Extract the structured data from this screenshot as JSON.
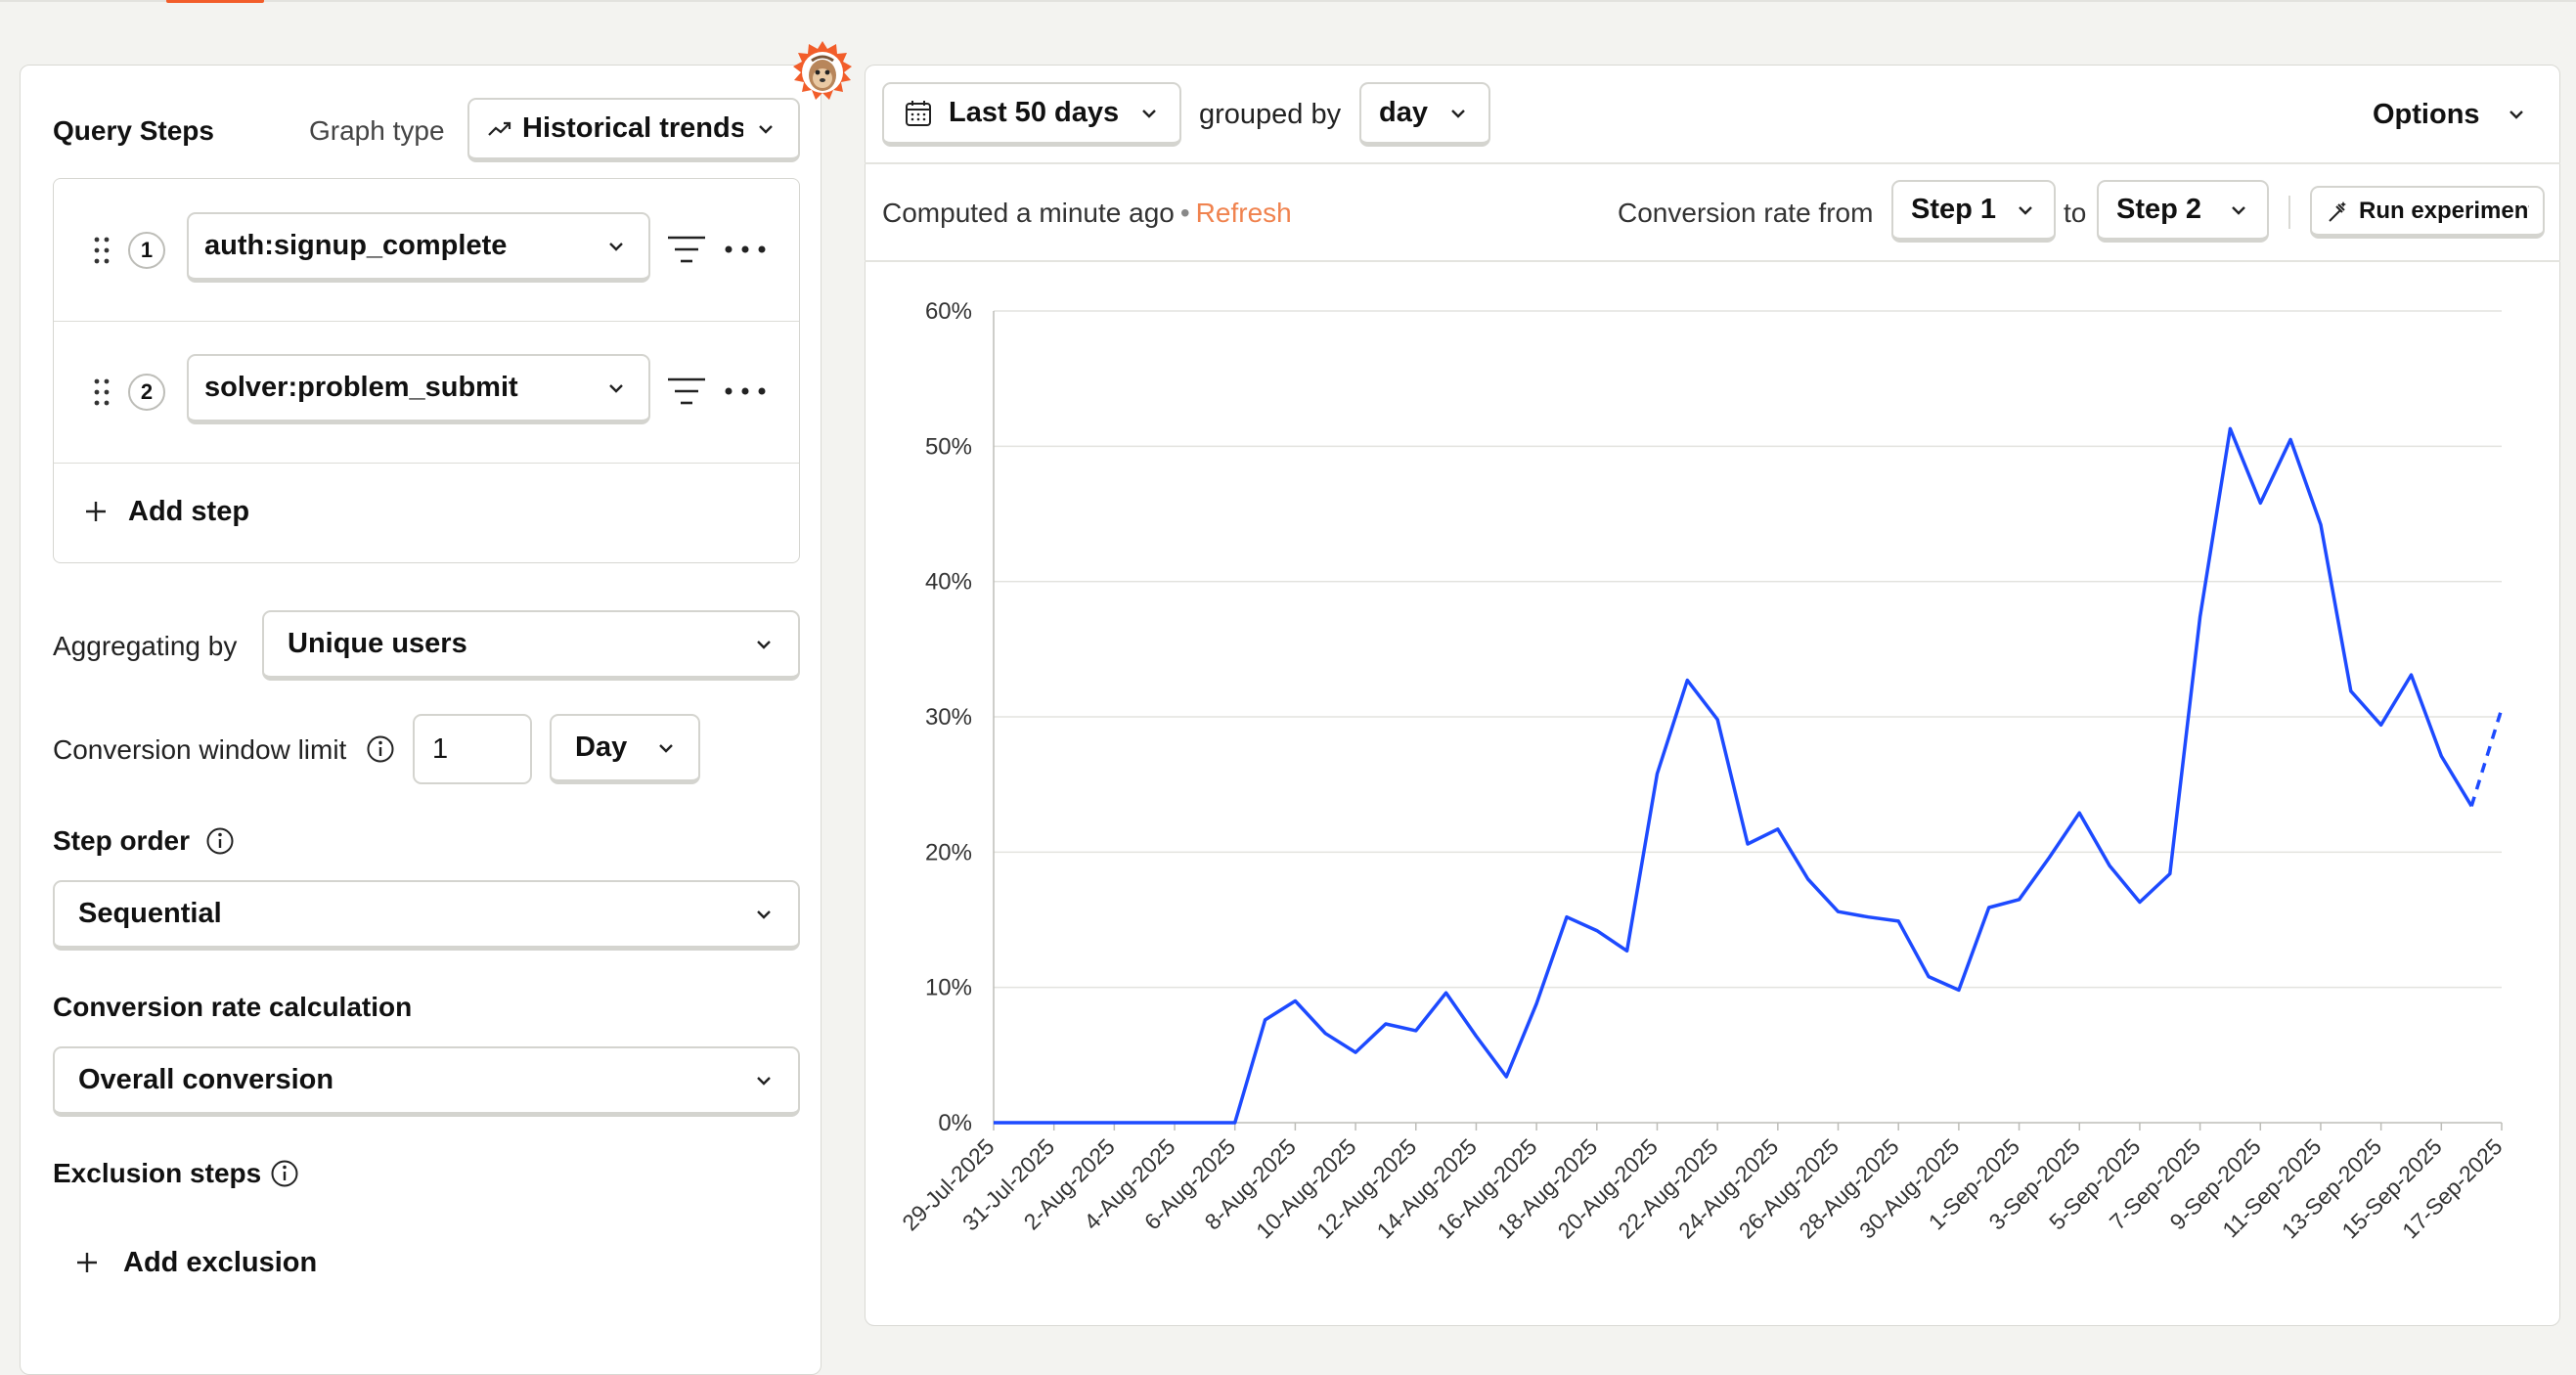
{
  "query_panel": {
    "title": "Query Steps",
    "graph_type_label": "Graph type",
    "graph_type_value": "Historical trends",
    "steps": [
      {
        "number": "1",
        "event": "auth:signup_complete"
      },
      {
        "number": "2",
        "event": "solver:problem_submit"
      }
    ],
    "add_step_label": "Add step",
    "aggregating_label": "Aggregating by",
    "aggregating_value": "Unique users",
    "conversion_window_label": "Conversion window limit",
    "conversion_window_value": "1",
    "conversion_window_unit": "Day",
    "step_order_label": "Step order",
    "step_order_value": "Sequential",
    "conversion_calc_label": "Conversion rate calculation",
    "conversion_calc_value": "Overall conversion",
    "exclusion_label": "Exclusion steps",
    "add_exclusion_label": "Add exclusion"
  },
  "toolbar": {
    "date_range": "Last 50 days",
    "grouped_by_label": "grouped by",
    "interval": "day",
    "options_label": "Options",
    "computed_label": "Computed a minute ago",
    "separator": "•",
    "refresh_label": "Refresh",
    "conversion_from_label": "Conversion rate from",
    "from_step": "Step 1",
    "to_label": "to",
    "to_step": "Step 2",
    "run_experiment_label": "Run experiment"
  },
  "colors": {
    "line": "#1d4aff",
    "accent": "#f25d2a",
    "refresh": "#f0834f"
  },
  "chart_data": {
    "type": "line",
    "ylim": [
      0,
      60
    ],
    "y_ticks": [
      0,
      10,
      20,
      30,
      40,
      50,
      60
    ],
    "y_tick_labels": [
      "0%",
      "10%",
      "20%",
      "30%",
      "40%",
      "50%",
      "60%"
    ],
    "grid": true,
    "x": [
      "29-Jul-2025",
      "30-Jul-2025",
      "31-Jul-2025",
      "1-Aug-2025",
      "2-Aug-2025",
      "3-Aug-2025",
      "4-Aug-2025",
      "5-Aug-2025",
      "6-Aug-2025",
      "7-Aug-2025",
      "8-Aug-2025",
      "9-Aug-2025",
      "10-Aug-2025",
      "11-Aug-2025",
      "12-Aug-2025",
      "13-Aug-2025",
      "14-Aug-2025",
      "15-Aug-2025",
      "16-Aug-2025",
      "17-Aug-2025",
      "18-Aug-2025",
      "19-Aug-2025",
      "20-Aug-2025",
      "21-Aug-2025",
      "22-Aug-2025",
      "23-Aug-2025",
      "24-Aug-2025",
      "25-Aug-2025",
      "26-Aug-2025",
      "27-Aug-2025",
      "28-Aug-2025",
      "29-Aug-2025",
      "30-Aug-2025",
      "31-Aug-2025",
      "1-Sep-2025",
      "2-Sep-2025",
      "3-Sep-2025",
      "4-Sep-2025",
      "5-Sep-2025",
      "6-Sep-2025",
      "7-Sep-2025",
      "8-Sep-2025",
      "9-Sep-2025",
      "10-Sep-2025",
      "11-Sep-2025",
      "12-Sep-2025",
      "13-Sep-2025",
      "14-Sep-2025",
      "15-Sep-2025",
      "16-Sep-2025",
      "17-Sep-2025"
    ],
    "x_tick_labels": [
      "29-Jul-2025",
      "31-Jul-2025",
      "2-Aug-2025",
      "4-Aug-2025",
      "6-Aug-2025",
      "8-Aug-2025",
      "10-Aug-2025",
      "12-Aug-2025",
      "14-Aug-2025",
      "16-Aug-2025",
      "18-Aug-2025",
      "20-Aug-2025",
      "22-Aug-2025",
      "24-Aug-2025",
      "26-Aug-2025",
      "28-Aug-2025",
      "30-Aug-2025",
      "1-Sep-2025",
      "3-Sep-2025",
      "5-Sep-2025",
      "7-Sep-2025",
      "9-Sep-2025",
      "11-Sep-2025",
      "13-Sep-2025",
      "15-Sep-2025",
      "17-Sep-2025"
    ],
    "series": [
      {
        "values": [
          0,
          0,
          0,
          0,
          0,
          0,
          0,
          0,
          0,
          7.6,
          9.0,
          6.6,
          5.2,
          7.3,
          6.8,
          9.6,
          6.4,
          3.4,
          8.8,
          15.2,
          14.2,
          12.7,
          25.8,
          32.7,
          29.8,
          20.6,
          21.7,
          18.0,
          15.6,
          15.2,
          14.9,
          10.8,
          9.8,
          15.9,
          16.5,
          19.6,
          22.9,
          19.0,
          16.3,
          18.4,
          37.4,
          51.3,
          45.8,
          50.5,
          44.2,
          31.9,
          29.4,
          33.1,
          27.1,
          23.4,
          30.6
        ],
        "partial_last_segment": true
      }
    ]
  }
}
